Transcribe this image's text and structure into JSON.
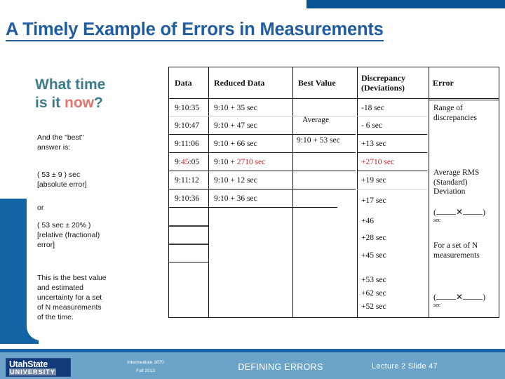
{
  "slide": {
    "title": "A Timely  Example of Errors in Measurements",
    "accent_blue": "#1f5ca0",
    "accent_teal": "#3d7b8c",
    "accent_red": "#e4736b",
    "table_red": "#c1272d"
  },
  "left": {
    "lead_part1": "What time",
    "lead_part2": "is it ",
    "lead_accent": "now",
    "lead_part3": "?",
    "para1": "And the \"best\"\nanswer is:",
    "para2": "( 53 ± 9 ) sec\n[absolute error]",
    "para3": "or",
    "para4": "( 53 sec ± 20% )\n[relative (fractional)\nerror]",
    "para5": "This is the best value\nand estimated\nuncertainty for a set\nof N measurements\nof the time."
  },
  "table": {
    "headers": [
      "Data",
      "Reduced Data",
      "Best Value",
      "Discrepancy\n(Deviations)",
      "Error"
    ],
    "data_col": [
      "9:10:35",
      "9:10:47",
      "9:11:06",
      "9:45:05",
      "9:11:12",
      "9:10:36"
    ],
    "data_col_red_part": "45",
    "reduced_col": [
      "9:10 + 35 sec",
      "9:10 + 47 sec",
      "9:10 + 66 sec",
      "9:10 + 2710 sec",
      "9:10 + 12 sec",
      "9:10 + 36 sec"
    ],
    "reduced_red_row_prefix": "9:10 + ",
    "reduced_red_row_value": "2710 sec",
    "best_value_label": "Average",
    "best_value_result": "9:10 + 53 sec",
    "discrepancy": [
      "-18 sec",
      "- 6 sec",
      "+13 sec",
      "+2710 sec",
      "+19 sec",
      "+17 sec",
      "+46",
      "+28 sec",
      "+45 sec",
      "+53 sec",
      "+62 sec",
      "+52 sec"
    ],
    "discrepancy_red_index": 3,
    "error_col": {
      "range": "Range of\ndiscrepancies",
      "rms": "Average RMS\n(Standard)\nDeviation",
      "formula1_open": "(",
      "formula1_op": "✕",
      "formula1_close": ")",
      "formula1_unit": "sec",
      "set_note": "For a set of N\nmeasurements",
      "formula2_open": "(",
      "formula2_op": "✕",
      "formula2_close": ")",
      "formula2_unit": "sec"
    }
  },
  "footer": {
    "logo_line1": "UtahState",
    "logo_line2": "UNIVERSITY",
    "course_line1": "Intermediate 3870",
    "course_line2": "Fall 2013",
    "section_title": "DEFINING ERRORS",
    "lecture": "Lecture  2   Slide  47"
  }
}
